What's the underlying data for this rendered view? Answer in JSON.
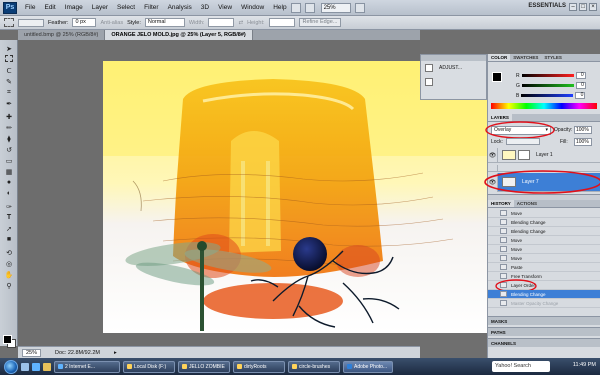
{
  "menubar": {
    "logo": "Ps",
    "menus": [
      "File",
      "Edit",
      "Image",
      "Layer",
      "Select",
      "Filter",
      "Analysis",
      "3D",
      "View",
      "Window",
      "Help"
    ],
    "zoom": "25%",
    "workspace": "ESSENTIALS",
    "window_controls": [
      "–",
      "□",
      "×"
    ]
  },
  "optbar": {
    "feather_label": "Feather:",
    "feather_value": "0 px",
    "antialias": "Anti-alias",
    "style_label": "Style:",
    "style_value": "Normal",
    "width_label": "Width:",
    "height_label": "Height:",
    "refine": "Refine Edge..."
  },
  "tabs": [
    {
      "label": "untitled.bmp @ 25% (RGB/8#)",
      "active": false
    },
    {
      "label": "ORANGE JELO MOLD.jpg @ 25% (Layer 5, RGB/8#)",
      "active": true
    }
  ],
  "status": {
    "zoom": "25%",
    "doc": "Doc: 22.8M/92.2M"
  },
  "minipanel": {
    "label": "ADJUST..."
  },
  "color_panel": {
    "tabs": [
      "COLOR",
      "SWATCHES",
      "STYLES"
    ],
    "channels": [
      {
        "label": "R",
        "value": "0",
        "color": "#ff3030"
      },
      {
        "label": "G",
        "value": "0",
        "color": "#30c030"
      },
      {
        "label": "B",
        "value": "0",
        "color": "#3050ff"
      }
    ]
  },
  "layers_panel": {
    "tab": "LAYERS",
    "blend_mode": "Overlay",
    "opacity_label": "Opacity:",
    "opacity_value": "100%",
    "lock_label": "Lock:",
    "fill_label": "Fill:",
    "fill_value": "100%",
    "layers": [
      {
        "name": "Layer 1",
        "selected": false
      },
      {
        "name": "Layer 7",
        "selected": true
      }
    ]
  },
  "history_panel": {
    "tabs": [
      "HISTORY",
      "ACTIONS"
    ],
    "items": [
      {
        "label": "Move",
        "state": "normal"
      },
      {
        "label": "Blending Change",
        "state": "normal"
      },
      {
        "label": "Blending Change",
        "state": "normal"
      },
      {
        "label": "Move",
        "state": "normal"
      },
      {
        "label": "Move",
        "state": "normal"
      },
      {
        "label": "Move",
        "state": "normal"
      },
      {
        "label": "Paste",
        "state": "normal"
      },
      {
        "label": "Free Transform",
        "state": "normal"
      },
      {
        "label": "Layer Order",
        "state": "normal"
      },
      {
        "label": "Blending Change",
        "state": "selected"
      },
      {
        "label": "Master Opacity Change",
        "state": "dim"
      }
    ]
  },
  "collapsed_panels": [
    "MASKS",
    "PATHS",
    "CHANNELS"
  ],
  "taskbar": {
    "buttons": [
      {
        "label": "2 Internet E...",
        "active": false
      },
      {
        "label": "Local Disk (F:)",
        "active": false
      },
      {
        "label": "JELLO ZOMBIE",
        "active": false
      },
      {
        "label": "dirtyRoots",
        "active": false
      },
      {
        "label": "circle-brushes",
        "active": false
      },
      {
        "label": "Adobe Photo...",
        "active": true
      }
    ],
    "search_placeholder": "Yahoo! Search",
    "clock": "11:49 PM"
  },
  "accent_color": "#3d7fd6",
  "annotation_color": "#e0101a"
}
